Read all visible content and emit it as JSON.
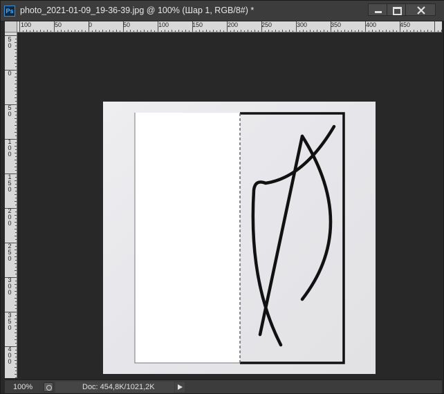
{
  "app": {
    "icon_label": "Ps",
    "title": "photo_2021-01-09_19-36-39.jpg @ 100% (Шар 1, RGB/8#) *"
  },
  "window_controls": {
    "minimize": "minimize-icon",
    "maximize": "maximize-icon",
    "close": "close-icon"
  },
  "ruler_top": {
    "labels": [
      "100",
      "50",
      "0",
      "50",
      "100",
      "150",
      "200",
      "250",
      "300",
      "350",
      "400",
      "450"
    ]
  },
  "ruler_left": {
    "labels": [
      "50",
      "0",
      "50",
      "100",
      "150",
      "200",
      "250",
      "300",
      "350",
      "400"
    ]
  },
  "status": {
    "zoom": "100%",
    "doc_info": "Doc: 454,8K/1021,2K"
  },
  "colors": {
    "app_bg": "#282828",
    "titlebar_bg": "#3c3c3c",
    "ruler_bg": "#d8d8d8",
    "document_bg": "#e8e8ea",
    "stroke": "#111111"
  }
}
